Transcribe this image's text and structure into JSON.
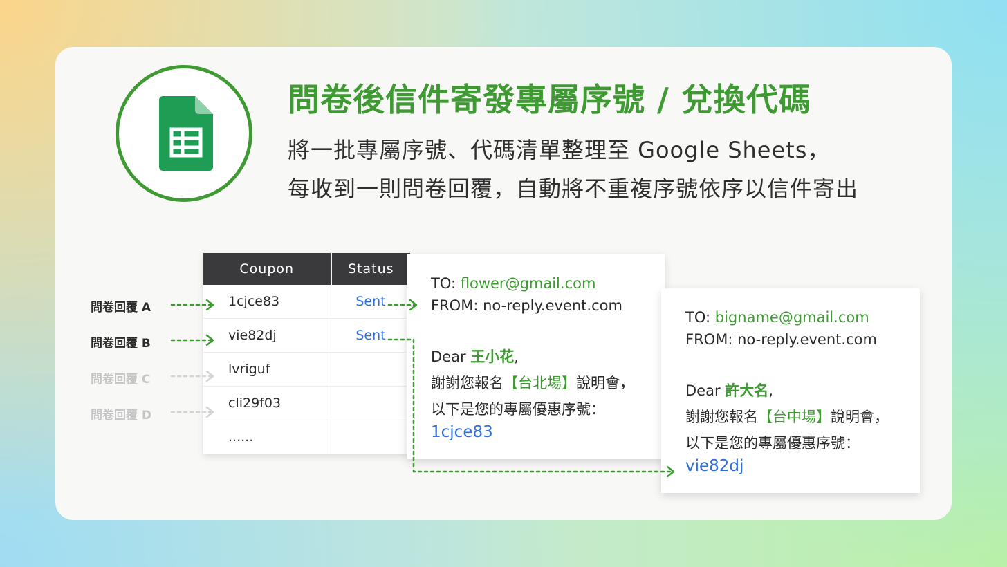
{
  "title": "問卷後信件寄發專屬序號 / 兌換代碼",
  "subtitle_line1": "將一批專屬序號、代碼清單整理至 Google Sheets，",
  "subtitle_line2": "每收到一則問卷回覆，自動將不重複序號依序以信件寄出",
  "logo_icon": "google-sheets-icon",
  "colors": {
    "accent_green": "#3f9a33",
    "link_blue": "#2f6fdb",
    "header_dark": "#3a3a3c"
  },
  "responses": [
    {
      "label": "問卷回覆 A",
      "active": true
    },
    {
      "label": "問卷回覆 B",
      "active": true
    },
    {
      "label": "問卷回覆 C",
      "active": false
    },
    {
      "label": "問卷回覆 D",
      "active": false
    }
  ],
  "table": {
    "headers": [
      "Coupon",
      "Status"
    ],
    "rows": [
      {
        "coupon": "1cjce83",
        "status": "Sent"
      },
      {
        "coupon": "vie82dj",
        "status": "Sent"
      },
      {
        "coupon": "lvriguf",
        "status": ""
      },
      {
        "coupon": "cli29f03",
        "status": ""
      },
      {
        "coupon": "......",
        "status": ""
      }
    ]
  },
  "emails": [
    {
      "to_label": "TO:",
      "to": "flower@gmail.com",
      "from_label": "FROM:",
      "from": "no-reply.event.com",
      "greeting": "Dear",
      "name": "王小花",
      "comma": ",",
      "thanks_prefix": "謝謝您報名",
      "venue": "【台北場】",
      "thanks_suffix": "說明會，",
      "code_intro": "以下是您的專屬優惠序號：",
      "code": "1cjce83"
    },
    {
      "to_label": "TO:",
      "to": "bigname@gmail.com",
      "from_label": "FROM:",
      "from": "no-reply.event.com",
      "greeting": "Dear",
      "name": "許大名",
      "comma": ",",
      "thanks_prefix": "謝謝您報名",
      "venue": "【台中場】",
      "thanks_suffix": "說明會，",
      "code_intro": "以下是您的專屬優惠序號：",
      "code": "vie82dj"
    }
  ]
}
